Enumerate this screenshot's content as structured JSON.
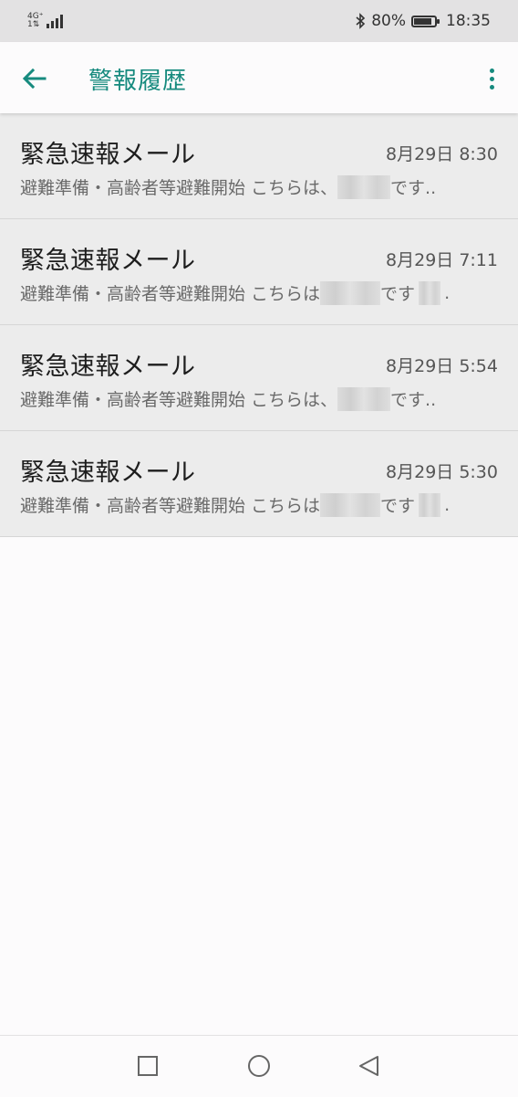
{
  "status_bar": {
    "network_top": "4G⁺",
    "network_bottom": "1⇅",
    "battery_percent": "80%",
    "battery_level": 0.8,
    "time": "18:35",
    "icons": [
      "signal-icon",
      "bluetooth-icon",
      "battery-icon"
    ]
  },
  "app_bar": {
    "title": "警報履歴",
    "accent_color": "#168a7e",
    "icons": [
      "back-arrow-icon",
      "more-vert-icon"
    ]
  },
  "messages": [
    {
      "title": "緊急速報メール",
      "time": "8月29日 8:30",
      "body_prefix": "避難準備・高齢者等避難開始 こちらは、",
      "body_suffix": "です..",
      "trailing_redacted": false
    },
    {
      "title": "緊急速報メール",
      "time": "8月29日 7:11",
      "body_prefix": "避難準備・高齢者等避難開始 こちらは",
      "body_suffix": "です",
      "trailing_redacted": true,
      "trailing_text": "."
    },
    {
      "title": "緊急速報メール",
      "time": "8月29日 5:54",
      "body_prefix": "避難準備・高齢者等避難開始 こちらは、",
      "body_suffix": "です..",
      "trailing_redacted": false
    },
    {
      "title": "緊急速報メール",
      "time": "8月29日 5:30",
      "body_prefix": "避難準備・高齢者等避難開始 こちらは",
      "body_suffix": "です",
      "trailing_redacted": true,
      "trailing_text": "."
    }
  ],
  "nav_bar": {
    "icons": [
      "square-recents-icon",
      "circle-home-icon",
      "triangle-back-icon"
    ]
  }
}
